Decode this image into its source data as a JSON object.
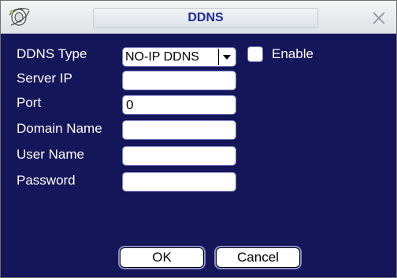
{
  "window": {
    "title": "DDNS",
    "logo_icon": "ie-like-logo-icon",
    "close_icon": "close-icon"
  },
  "form": {
    "ddns_type": {
      "label": "DDNS Type",
      "value": "NO-IP DDNS"
    },
    "enable": {
      "label": "Enable",
      "checked": false
    },
    "server_ip": {
      "label": "Server IP",
      "value": ""
    },
    "port": {
      "label": "Port",
      "value": "0"
    },
    "domain_name": {
      "label": "Domain Name",
      "value": ""
    },
    "user_name": {
      "label": "User Name",
      "value": ""
    },
    "password": {
      "label": "Password",
      "value": ""
    }
  },
  "buttons": {
    "ok": "OK",
    "cancel": "Cancel"
  },
  "colors": {
    "background": "#15155a",
    "title_text": "#1b2a98",
    "label_text": "#ffffff"
  }
}
